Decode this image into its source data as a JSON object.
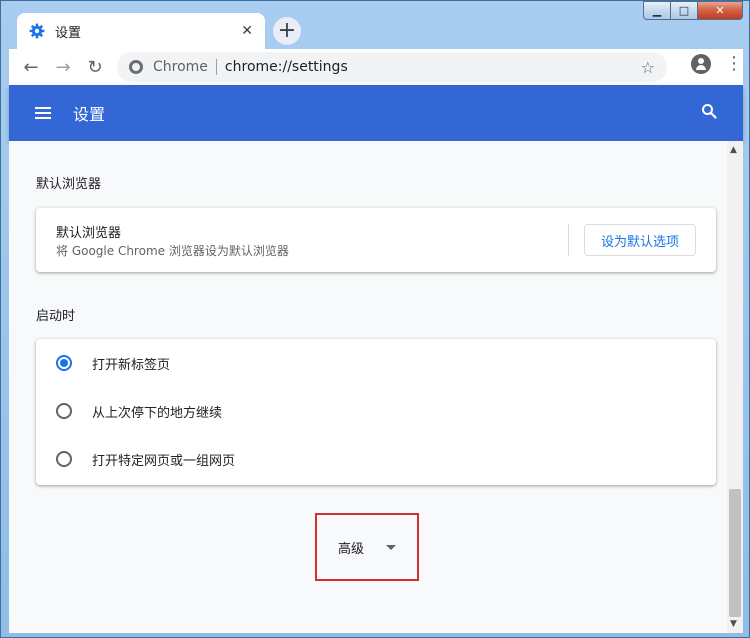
{
  "tab": {
    "title": "设置",
    "close": "✕"
  },
  "newtab": {
    "glyph": "+"
  },
  "window_controls": {
    "minimize": "▁",
    "maximize": "□",
    "close": "✕"
  },
  "toolbar": {
    "back": "←",
    "forward": "→",
    "reload": "↻",
    "host": "Chrome",
    "url": "chrome://settings",
    "star": "☆",
    "menu": "⋮"
  },
  "header": {
    "title": "设置"
  },
  "default_browser": {
    "section_title": "默认浏览器",
    "card_title": "默认浏览器",
    "card_subtitle": "将 Google Chrome 浏览器设为默认浏览器",
    "button_label": "设为默认选项"
  },
  "on_startup": {
    "section_title": "启动时",
    "options": [
      {
        "label": "打开新标签页",
        "checked": true
      },
      {
        "label": "从上次停下的地方继续",
        "checked": false
      },
      {
        "label": "打开特定网页或一组网页",
        "checked": false
      }
    ]
  },
  "advanced": {
    "label": "高级"
  },
  "scrollbar": {
    "up": "▲",
    "down": "▼"
  },
  "colors": {
    "accent": "#3367d6",
    "link": "#1a73e8",
    "highlight": "#d0312d"
  },
  "icons": {
    "tab_favicon": "gear-icon",
    "header_menu": "hamburger-icon",
    "header_search": "search-icon",
    "account": "account-icon"
  }
}
